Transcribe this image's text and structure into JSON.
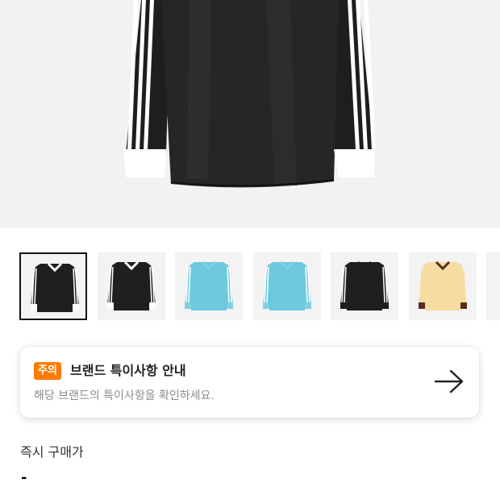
{
  "product": {
    "image_alt": "black long sleeve jersey with three white stripes",
    "thumbnails": [
      {
        "name": "black-jersey-front",
        "color": "#1f1f1f",
        "stripe": "#ffffff",
        "cuff": "#ffffff",
        "selected": true
      },
      {
        "name": "black-jersey-front-alt",
        "color": "#1f1f1f",
        "stripe": "#ffffff",
        "cuff": "#ffffff",
        "selected": false
      },
      {
        "name": "blue-jersey-front",
        "color": "#6cc9de",
        "stripe": "#ffffff",
        "cuff": "#7fd1e3",
        "selected": false
      },
      {
        "name": "blue-jersey-front-alt",
        "color": "#6cc9de",
        "stripe": "#ffffff",
        "cuff": "#7fd1e3",
        "selected": false
      },
      {
        "name": "black-jersey-back",
        "color": "#1f1f1f",
        "stripe": "#ffffff",
        "cuff": "#1f1f1f",
        "selected": false
      },
      {
        "name": "cream-jersey-front",
        "color": "#f6dca0",
        "stripe": "#f6dca0",
        "cuff": "#5a2a1e",
        "selected": false
      }
    ]
  },
  "notice": {
    "badge": "주의",
    "title": "브랜드 특이사항 안내",
    "description": "해당 브랜드의 특이사항을 확인하세요.",
    "arrow_icon": "arrow-right-icon"
  },
  "price": {
    "label": "즉시 구매가",
    "value": "-"
  },
  "colors": {
    "badge_bg": "#ff7a00",
    "hero_bg": "#f2f2f2"
  }
}
